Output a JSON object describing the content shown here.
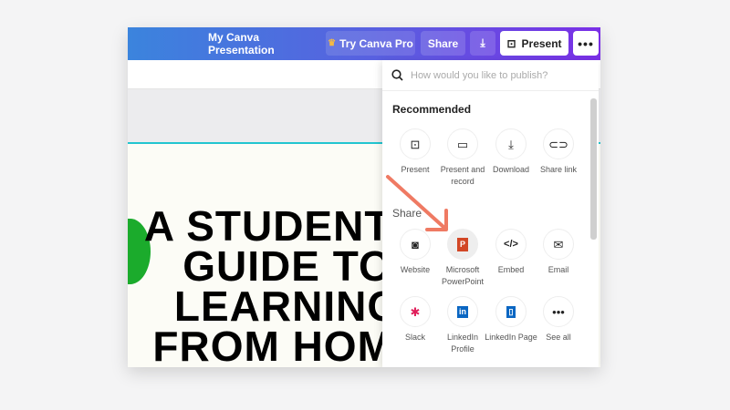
{
  "header": {
    "title": "My Canva Presentation",
    "try_pro": "Try Canva Pro",
    "share": "Share",
    "present": "Present",
    "more": "•••"
  },
  "slide": {
    "lines": [
      "A STUDENT'S",
      "GUIDE TO",
      "LEARNING",
      "FROM HOME"
    ]
  },
  "panel": {
    "search_placeholder": "How would you like to publish?",
    "recommended_title": "Recommended",
    "recommended": [
      {
        "label": "Present",
        "icon": "present-icon"
      },
      {
        "label": "Present and record",
        "icon": "video-icon"
      },
      {
        "label": "Download",
        "icon": "download-icon"
      },
      {
        "label": "Share link",
        "icon": "link-icon"
      }
    ],
    "share_title": "Share",
    "share": [
      {
        "label": "Website",
        "icon": "website-icon"
      },
      {
        "label": "Microsoft PowerPoint",
        "icon": "powerpoint-icon"
      },
      {
        "label": "Embed",
        "icon": "embed-icon"
      },
      {
        "label": "Email",
        "icon": "email-icon"
      },
      {
        "label": "Slack",
        "icon": "slack-icon"
      },
      {
        "label": "LinkedIn Profile",
        "icon": "linkedin-icon"
      },
      {
        "label": "LinkedIn Page",
        "icon": "linkedin-page-icon"
      },
      {
        "label": "See all",
        "icon": "more-icon"
      }
    ]
  },
  "colors": {
    "accent_start": "#3b84dd",
    "accent_end": "#7a2fe6",
    "arrow": "#ef7a63",
    "teal": "#22c5d0"
  }
}
